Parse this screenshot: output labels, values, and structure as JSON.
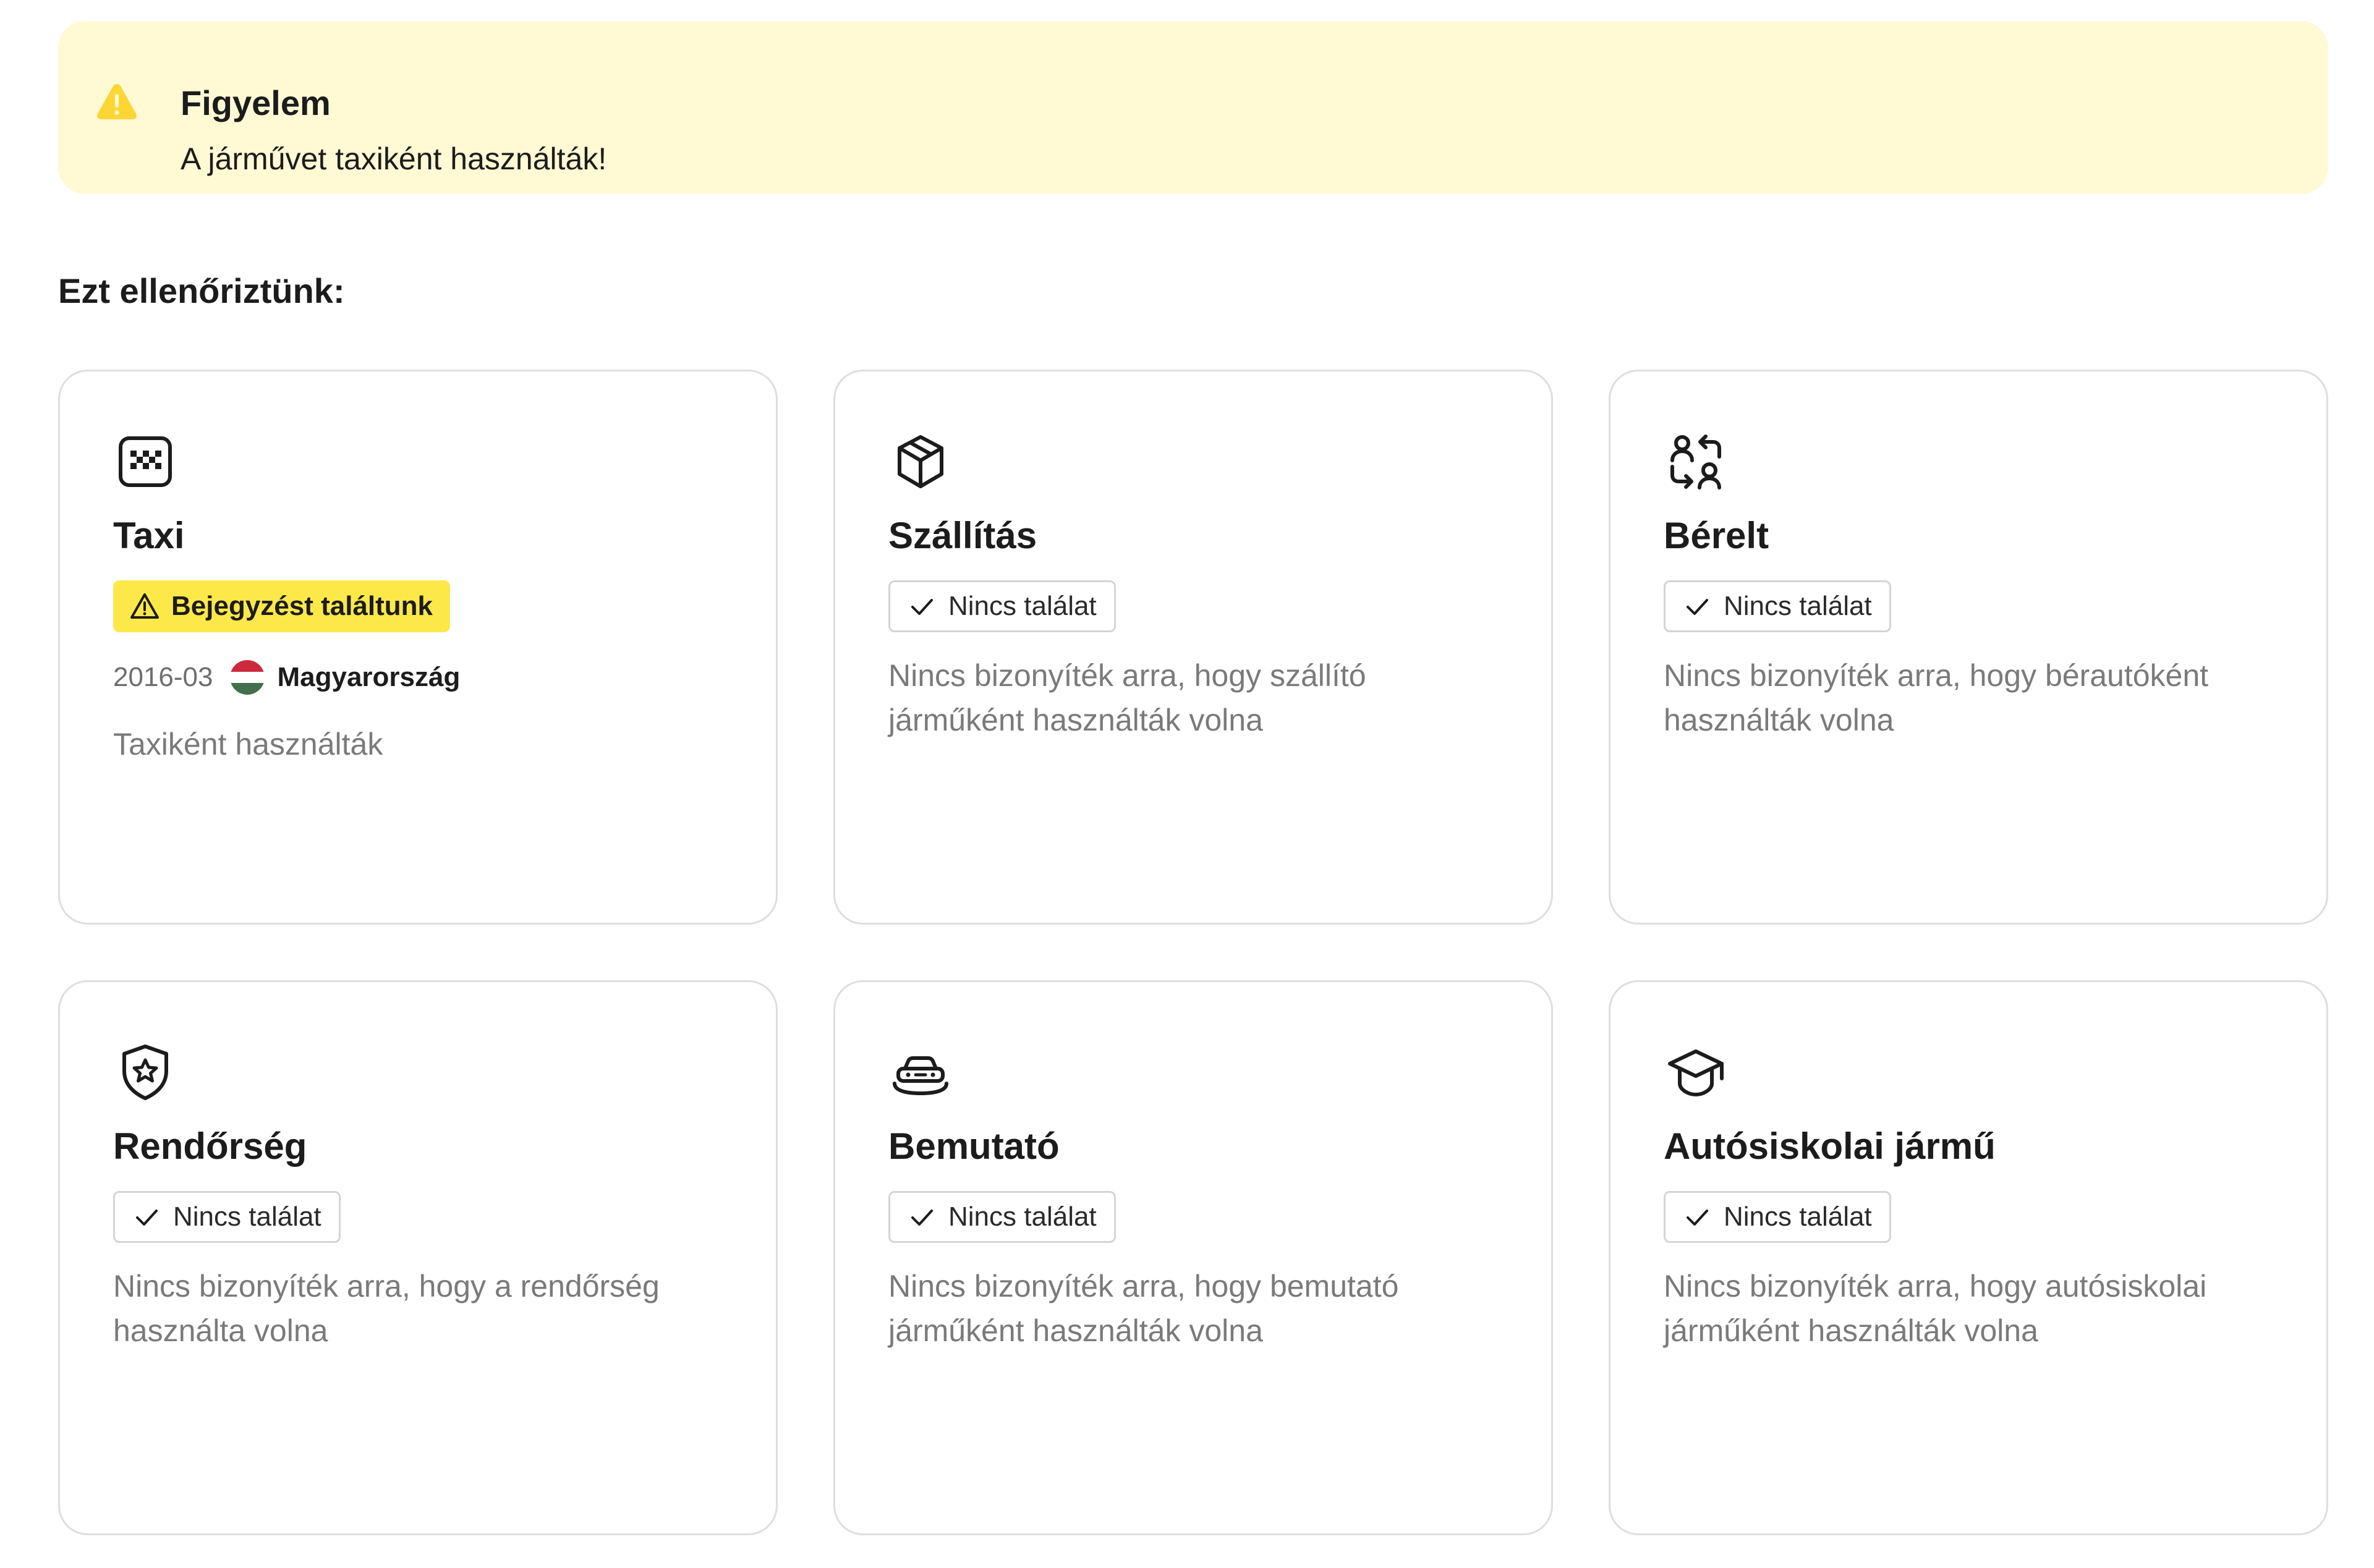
{
  "alert": {
    "title": "Figyelem",
    "text": "A járművet taxiként használták!",
    "icon": "warning-triangle-icon",
    "background_color": "#fff9d4",
    "icon_color": "#fcd634"
  },
  "section_title": "Ezt ellenőriztünk:",
  "cards": [
    {
      "title": "Taxi",
      "icon": "taxi-sign-icon",
      "badge_label": "Bejegyzést találtunk",
      "badge_icon": "warning-triangle-icon",
      "badge_color": "#fde84a",
      "record": {
        "date": "2016-03",
        "country": "Magyarország",
        "flag_icon": "hungary-flag-icon",
        "flag_colors": [
          "#cd2a3e",
          "#ffffff",
          "#436f4d"
        ],
        "description": "Taxiként használták"
      }
    },
    {
      "title": "Szállítás",
      "icon": "package-box-icon",
      "badge_label": "Nincs találat",
      "badge_icon": "check-icon",
      "description": "Nincs bizonyíték arra, hogy szállító járműként használták volna"
    },
    {
      "title": "Bérelt",
      "icon": "user-swap-icon",
      "badge_label": "Nincs találat",
      "badge_icon": "check-icon",
      "description": "Nincs bizonyíték arra, hogy bérautóként használták volna"
    },
    {
      "title": "Rendőrség",
      "icon": "police-badge-icon",
      "badge_label": "Nincs találat",
      "badge_icon": "check-icon",
      "description": "Nincs bizonyíték arra, hogy a rendőrség használta volna"
    },
    {
      "title": "Bemutató",
      "icon": "car-showroom-icon",
      "badge_label": "Nincs találat",
      "badge_icon": "check-icon",
      "description": "Nincs bizonyíték arra, hogy bemutató járműként használták volna"
    },
    {
      "title": "Autósiskolai jármű",
      "icon": "graduation-cap-icon",
      "badge_label": "Nincs találat",
      "badge_icon": "check-icon",
      "description": "Nincs bizonyíték arra, hogy autósiskolai járműként használták volna"
    }
  ]
}
